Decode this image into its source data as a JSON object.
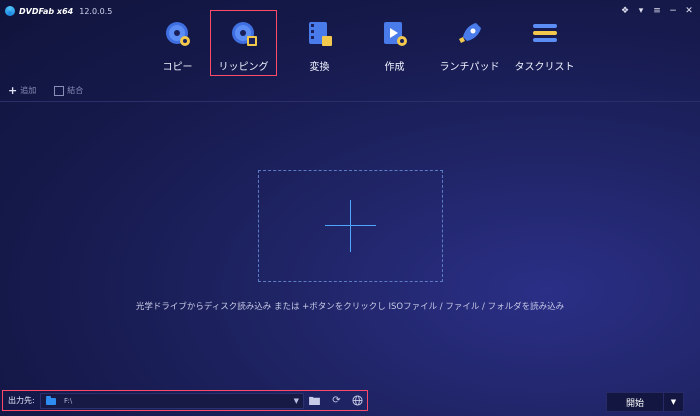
{
  "app": {
    "name": "DVDFab x64",
    "version": "12.0.0.5",
    "window_controls": [
      {
        "name": "tray-icon",
        "glyph": "❖"
      },
      {
        "name": "settings-icon",
        "glyph": "▾"
      },
      {
        "name": "menu-icon",
        "glyph": "≡"
      },
      {
        "name": "minimize-icon",
        "glyph": "−"
      },
      {
        "name": "close-icon",
        "glyph": "✕"
      }
    ]
  },
  "nav": {
    "items": [
      {
        "label": "コピー",
        "icon": "disc-copy-icon"
      },
      {
        "label": "リッピング",
        "icon": "disc-rip-icon",
        "selected": true
      },
      {
        "label": "変換",
        "icon": "film-convert-icon"
      },
      {
        "label": "作成",
        "icon": "video-create-icon"
      },
      {
        "label": "ランチパッド",
        "icon": "rocket-icon"
      },
      {
        "label": "タスクリスト",
        "icon": "task-list-icon"
      }
    ]
  },
  "toolbar": {
    "add_label": "追加",
    "merge_label": "結合"
  },
  "main": {
    "hint": "光学ドライブからディスク読み込み または +ボタンをクリックし ISOファイル / ファイル / フォルダを読み込み"
  },
  "bottom": {
    "output_label": "出力先:",
    "output_path": "F:\\",
    "start_label": "開始"
  },
  "colors": {
    "highlight": "#ff4a6a",
    "accent": "#4ea7ff",
    "background": "#161a4d"
  }
}
